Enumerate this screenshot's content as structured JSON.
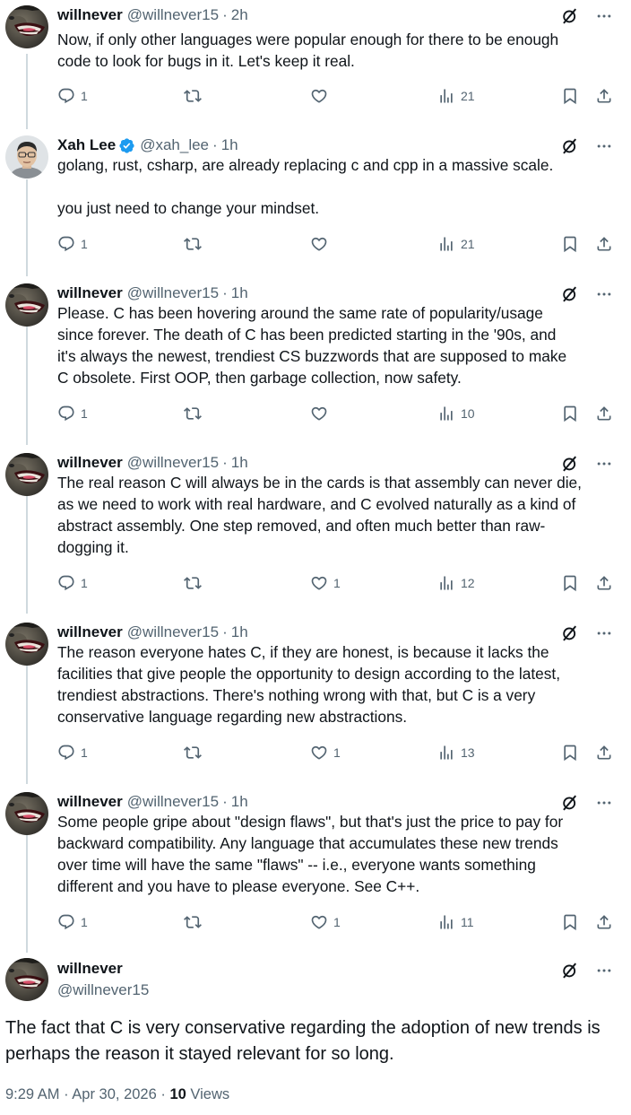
{
  "tweets": [
    {
      "name": "willnever",
      "handle": "@willnever15",
      "time": "2h",
      "text": "Now, if only other languages were popular enough for there to be enough\ncode to look for bugs in it. Let's keep it real.",
      "replies": "1",
      "reposts": "",
      "likes": "",
      "views": "21"
    },
    {
      "name": "Xah Lee",
      "handle": "@xah_lee",
      "time": "1h",
      "verified": true,
      "text": "golang, rust, csharp, are already replacing c and cpp in a massive scale.\n\nyou just need to change your mindset.",
      "replies": "1",
      "reposts": "",
      "likes": "",
      "views": "21"
    },
    {
      "name": "willnever",
      "handle": "@willnever15",
      "time": "1h",
      "text": "Please. C has been hovering around the same rate of popularity/usage\nsince forever. The death of C has been predicted starting in the '90s, and\nit's always the newest, trendiest CS buzzwords that are supposed to make\nC obsolete. First OOP, then garbage collection, now safety.",
      "replies": "1",
      "reposts": "",
      "likes": "",
      "views": "10"
    },
    {
      "name": "willnever",
      "handle": "@willnever15",
      "time": "1h",
      "text": "The real reason C will always be in the cards is that assembly can never die,\nas we need to work with real hardware, and C evolved naturally as a kind of\nabstract assembly. One step removed, and often much better than raw-\ndogging it.",
      "replies": "1",
      "reposts": "",
      "likes": "1",
      "views": "12"
    },
    {
      "name": "willnever",
      "handle": "@willnever15",
      "time": "1h",
      "text": "The reason everyone hates C, if they are honest, is because it lacks the\nfacilities that give people the opportunity to design according to the latest,\ntrendiest abstractions. There's nothing wrong with that, but C is a very\nconservative language regarding new abstractions.",
      "replies": "1",
      "reposts": "",
      "likes": "1",
      "views": "13"
    },
    {
      "name": "willnever",
      "handle": "@willnever15",
      "time": "1h",
      "text": "Some people gripe about \"design flaws\", but that's just the price to pay for\nbackward compatibility. Any language that accumulates these new trends\nover time will have the same \"flaws\" -- i.e., everyone wants something\ndifferent and you have to please everyone. See C++.",
      "replies": "1",
      "reposts": "",
      "likes": "1",
      "views": "11"
    }
  ],
  "main": {
    "name": "willnever",
    "handle": "@willnever15",
    "text": "The fact that C is very conservative regarding the adoption of new trends is perhaps the reason it stayed relevant for so long.",
    "timestamp": "9:29 AM · Apr 30, 2026 · ",
    "views_count": "10",
    "views_label": " Views"
  },
  "colors": {
    "text": "#0f1419",
    "muted": "#536471",
    "verified": "#1d9bf0",
    "thread_line": "#cfd9de"
  }
}
